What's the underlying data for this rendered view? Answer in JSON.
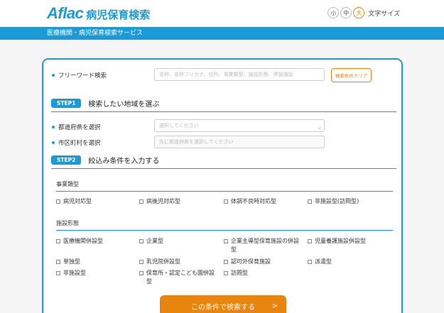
{
  "header": {
    "logo_word": "Aflac",
    "logo_sub": "病児保育検索",
    "fontsize_options": [
      "小",
      "中",
      "大"
    ],
    "fontsize_label": "文字サイズ"
  },
  "bar": {
    "text": "医療機関・病児保育検索サービス"
  },
  "free_search": {
    "label": "フリーワード検索",
    "placeholder": "名称、名称フリガナ、住所、事業類型、施設形態、併設施設",
    "clear_label": "検索条件クリア"
  },
  "step1": {
    "badge": "STEP1",
    "title": "検索したい地域を選ぶ",
    "prefecture_label": "都道府県を選択",
    "prefecture_placeholder": "選択してください",
    "city_label": "市区町村を選択",
    "city_placeholder": "先に都道府県を選択してください"
  },
  "step2": {
    "badge": "STEP2",
    "title": "絞込み条件を入力する",
    "business_type": {
      "title": "事業類型",
      "options": [
        "病児対応型",
        "病後児対応型",
        "体調不良時対応型",
        "非施設型(訪問型)"
      ]
    },
    "facility_type": {
      "title": "施設形態",
      "options": [
        "医療機関併設型",
        "企業型",
        "企業主導型保育施設の併設型",
        "児童養護施設併設型",
        "単独型",
        "乳児院併設型",
        "認可外保育施設",
        "派遣型",
        "非施設型",
        "保育所・認定こども園併設型",
        "訪問型"
      ]
    }
  },
  "search_button": {
    "label": "この条件で検索する",
    "arrow": ">"
  },
  "colors": {
    "brand": "#1a9bd7",
    "accent": "#e8850f"
  }
}
